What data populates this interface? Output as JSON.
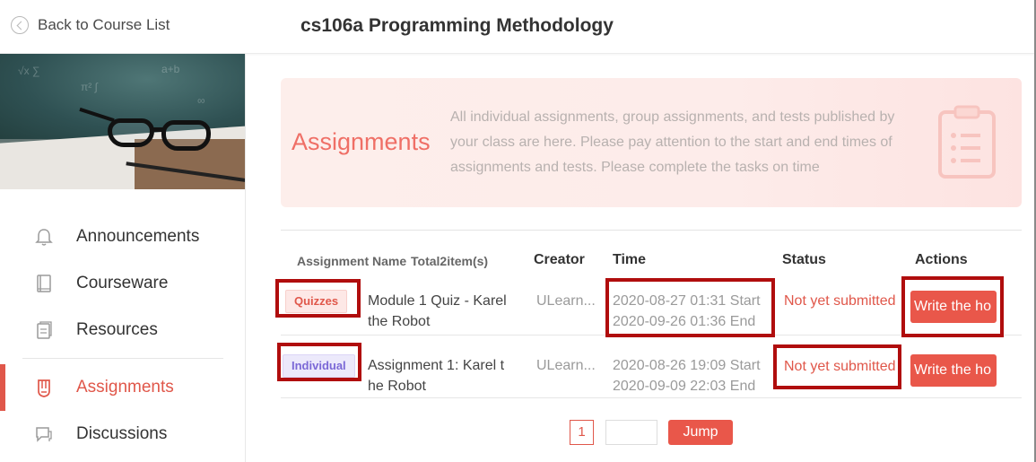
{
  "header": {
    "back_label": "Back to Course List",
    "course_title": "cs106a Programming Methodology"
  },
  "sidebar": {
    "items": [
      {
        "label": "Announcements",
        "icon": "bell-icon"
      },
      {
        "label": "Courseware",
        "icon": "book-icon"
      },
      {
        "label": "Resources",
        "icon": "files-icon"
      },
      {
        "label": "Assignments",
        "icon": "assignment-icon",
        "active": true
      },
      {
        "label": "Discussions",
        "icon": "chat-icon"
      }
    ]
  },
  "hero": {
    "title": "Assignments",
    "description": "All individual assignments, group assignments, and tests published by your class are here. Please pay attention to the start and end times of assignments and tests. Please complete the tasks on time"
  },
  "table": {
    "headers": {
      "name": "Assignment Name",
      "total": "Total2item(s)",
      "creator": "Creator",
      "time": "Time",
      "status": "Status",
      "actions": "Actions"
    },
    "rows": [
      {
        "tag": "Quizzes",
        "name_line1": "Module 1 Quiz - Karel",
        "name_line2": "the Robot",
        "creator": "ULearn...",
        "start": "2020-08-27 01:31 Start",
        "end": "2020-09-26 01:36 End",
        "status": "Not yet submitted",
        "action": "Write the ho"
      },
      {
        "tag": "Individual",
        "name_line1": "Assignment 1: Karel t",
        "name_line2": "he Robot",
        "creator": "ULearn...",
        "start": "2020-08-26 19:09 Start",
        "end": "2020-09-09 22:03 End",
        "status": "Not yet submitted",
        "action": "Write the ho"
      }
    ]
  },
  "pagination": {
    "current_page": "1",
    "jump_label": "Jump"
  },
  "colors": {
    "accent": "#e9574a",
    "highlight": "#b00d0d",
    "individual_tag": "#7b68d6"
  }
}
